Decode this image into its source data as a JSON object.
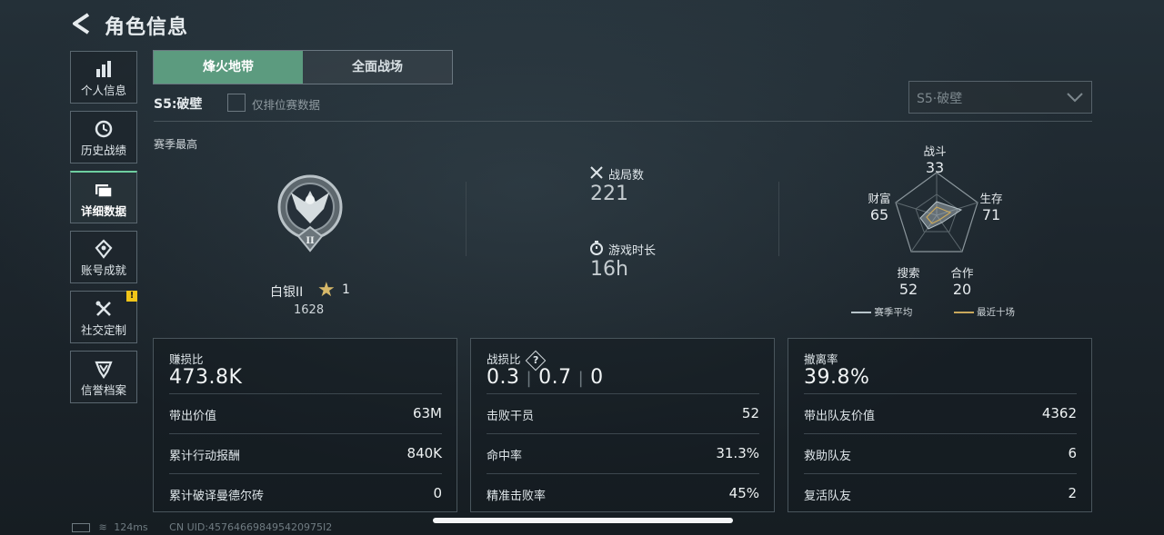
{
  "header": {
    "title": "角色信息"
  },
  "sidebar": {
    "items": [
      {
        "label": "个人信息",
        "icon": "bar-chart-icon"
      },
      {
        "label": "历史战绩",
        "icon": "history-clock-icon"
      },
      {
        "label": "详细数据",
        "icon": "folder-icon",
        "active": true
      },
      {
        "label": "账号成就",
        "icon": "achievement-icon"
      },
      {
        "label": "社交定制",
        "icon": "tools-icon",
        "badge": "!"
      },
      {
        "label": "信誉档案",
        "icon": "shield-icon"
      }
    ]
  },
  "tabs": [
    {
      "label": "烽火地带",
      "active": true
    },
    {
      "label": "全面战场",
      "active": false
    }
  ],
  "season": {
    "label": "S5:破壁",
    "ranked_only_label": "仅排位赛数据",
    "select_value": "S5·破壁"
  },
  "season_best": {
    "label": "赛季最高",
    "rank": "白银II",
    "stars": "1",
    "score": "1628",
    "tier_numeral": "II"
  },
  "stats": {
    "matches": {
      "label": "战局数",
      "value": "221"
    },
    "playtime": {
      "label": "游戏时长",
      "value": "16h"
    }
  },
  "radar": {
    "axes": [
      {
        "label": "战斗",
        "value": "33"
      },
      {
        "label": "生存",
        "value": "71"
      },
      {
        "label": "合作",
        "value": "20"
      },
      {
        "label": "搜索",
        "value": "52"
      },
      {
        "label": "财富",
        "value": "65"
      }
    ],
    "legend": {
      "season_avg": "赛季平均",
      "recent": "最近十场"
    },
    "colors": {
      "season_avg": "#b8c4ca",
      "recent": "#c9a85c"
    }
  },
  "cards": [
    {
      "title": "赚损比",
      "value": "473.8K",
      "rows": [
        {
          "k": "带出价值",
          "v": "63M"
        },
        {
          "k": "累计行动报酬",
          "v": "840K"
        },
        {
          "k": "累计破译曼德尔砖",
          "v": "0"
        }
      ]
    },
    {
      "title": "战损比",
      "help": "?",
      "values": [
        "0.3",
        "0.7",
        "0"
      ],
      "rows": [
        {
          "k": "击败干员",
          "v": "52"
        },
        {
          "k": "命中率",
          "v": "31.3%"
        },
        {
          "k": "精准击败率",
          "v": "45%"
        }
      ]
    },
    {
      "title": "撤离率",
      "value": "39.8%",
      "rows": [
        {
          "k": "带出队友价值",
          "v": "4362"
        },
        {
          "k": "救助队友",
          "v": "6"
        },
        {
          "k": "复活队友",
          "v": "2"
        }
      ]
    }
  ],
  "status": {
    "ping": "124ms",
    "uid": "CN UID:457646698495420975I2"
  }
}
